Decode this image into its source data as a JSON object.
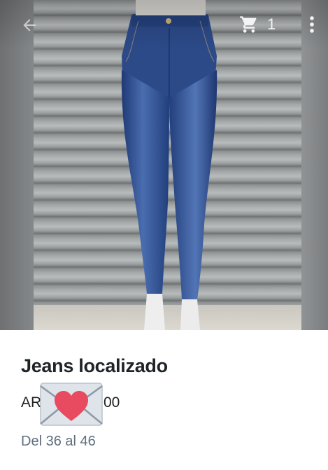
{
  "header": {
    "back_icon": "arrow-left-icon",
    "cart_icon": "shopping-cart-icon",
    "cart_count": "1",
    "more_icon": "more-vertical-icon"
  },
  "product": {
    "image_subject": "high-waisted blue skinny jeans on mannequin",
    "title": "Jeans localizado",
    "price_visible_start": "AR",
    "price_visible_end": "00",
    "price_obscured_by": "love-letter-emoji-icon",
    "size_range": "Del 36 al 46"
  },
  "colors": {
    "denim": "#2f4f8f",
    "title_text": "#1f2428",
    "muted_text": "#5f6e7e",
    "heart": "#e84a5f"
  }
}
